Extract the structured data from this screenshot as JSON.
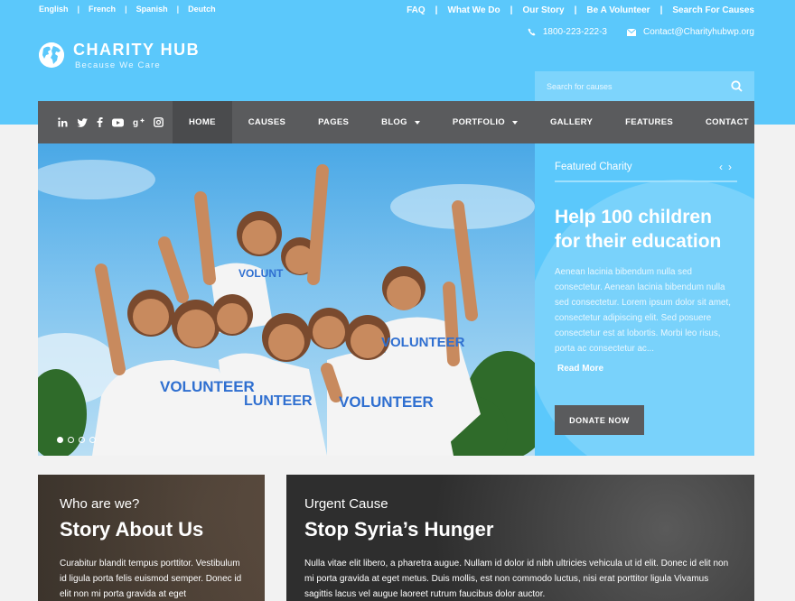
{
  "languages": [
    "English",
    "French",
    "Spanish",
    "Deutch"
  ],
  "top_links": [
    "FAQ",
    "What We Do",
    "Our Story",
    "Be A Volunteer",
    "Search For Causes"
  ],
  "contact": {
    "phone": "1800-223-222-3",
    "email": "Contact@Charityhubwp.org"
  },
  "brand": {
    "name": "CHARITY HUB",
    "tagline": "Because We Care"
  },
  "search": {
    "placeholder": "Search for causes"
  },
  "nav": [
    {
      "label": "HOME"
    },
    {
      "label": "CAUSES"
    },
    {
      "label": "PAGES"
    },
    {
      "label": "BLOG"
    },
    {
      "label": "PORTFOLIO"
    },
    {
      "label": "GALLERY"
    },
    {
      "label": "FEATURES"
    },
    {
      "label": "CONTACT"
    }
  ],
  "social_icons": [
    "linkedin-icon",
    "twitter-icon",
    "facebook-icon",
    "youtube-icon",
    "google-plus-icon",
    "instagram-icon"
  ],
  "featured": {
    "heading": "Featured Charity",
    "title": "Help 100 children for their education",
    "body": "Aenean lacinia bibendum nulla sed consectetur. Aenean lacinia bibendum nulla sed consectetur. Lorem ipsum dolor sit amet, consectetur adipiscing elit. Sed posuere consectetur est at lobortis. Morbi leo risus, porta ac consectetur ac...",
    "read_more": "Read More",
    "donate": "DONATE NOW"
  },
  "card_about": {
    "kicker": "Who are we?",
    "title": "Story About Us",
    "body": "Curabitur blandit tempus porttitor. Vestibulum id ligula porta felis euismod semper. Donec id elit non mi porta gravida at eget"
  },
  "card_cause": {
    "kicker": "Urgent Cause",
    "title": "Stop Syria’s Hunger",
    "body": "Nulla vitae elit libero, a pharetra augue. Nullam id dolor id nibh ultricies vehicula ut id elit. Donec id elit non mi porta gravida at eget metus. Duis mollis, est non commodo luctus, nisi erat porttitor ligula Vivamus sagittis lacus vel augue laoreet rutrum faucibus dolor auctor."
  },
  "colors": {
    "accent": "#5bc8fb",
    "nav": "#5a5b5d",
    "nav_active": "#4a4b4d"
  }
}
